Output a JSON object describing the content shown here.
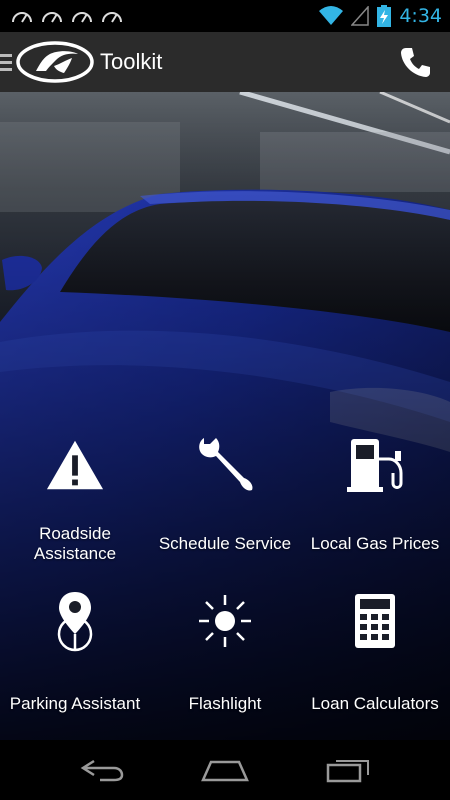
{
  "status_bar": {
    "time": "4:34",
    "notification_icons": [
      "speedometer-icon",
      "speedometer-icon",
      "speedometer-icon",
      "speedometer-icon"
    ],
    "icons": [
      "wifi-icon",
      "signal-icon",
      "battery-charging-icon"
    ],
    "accent_color": "#33b5e5"
  },
  "action_bar": {
    "title": "Toolkit",
    "logo": "hyundai-logo",
    "call_icon": "phone-icon"
  },
  "tools": [
    {
      "label": "Roadside Assistance",
      "icon": "warning-icon"
    },
    {
      "label": "Schedule Service",
      "icon": "wrench-icon"
    },
    {
      "label": "Local Gas Prices",
      "icon": "gas-pump-icon"
    },
    {
      "label": "Parking Assistant",
      "icon": "location-pin-icon"
    },
    {
      "label": "Flashlight",
      "icon": "sun-icon"
    },
    {
      "label": "Loan Calculators",
      "icon": "calculator-icon"
    }
  ],
  "nav_bar": {
    "icons": [
      "back-icon",
      "home-icon",
      "recent-apps-icon"
    ]
  }
}
